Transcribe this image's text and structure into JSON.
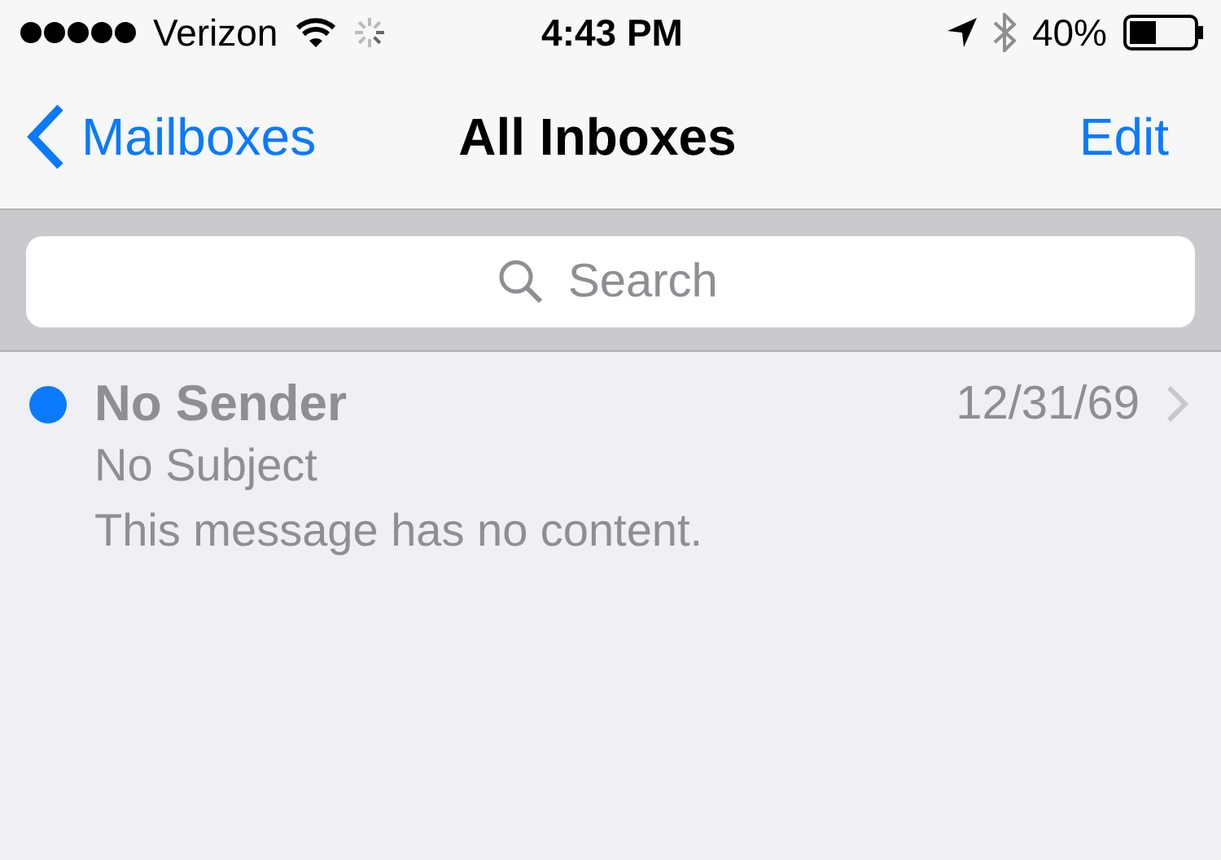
{
  "status_bar": {
    "carrier": "Verizon",
    "time": "4:43 PM",
    "battery": "40%"
  },
  "nav": {
    "back": "Mailboxes",
    "title": "All Inboxes",
    "action": "Edit"
  },
  "search": {
    "placeholder": "Search"
  },
  "messages": [
    {
      "sender": "No Sender",
      "subject": "No Subject",
      "preview": "This message has no content.",
      "date": "12/31/69",
      "unread": true
    }
  ]
}
